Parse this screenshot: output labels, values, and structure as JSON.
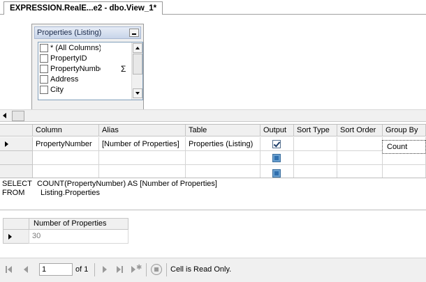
{
  "tab": {
    "title": "EXPRESSION.RealE...e2 - dbo.View_1*"
  },
  "diagram": {
    "table_title": "Properties (Listing)",
    "columns": [
      {
        "name": "* (All Columns)",
        "checked": false
      },
      {
        "name": "PropertyID",
        "checked": false
      },
      {
        "name": "PropertyNumbe",
        "checked": false,
        "aggregate_icon": "Σ"
      },
      {
        "name": "Address",
        "checked": false
      },
      {
        "name": "City",
        "checked": false
      }
    ]
  },
  "grid": {
    "headers": [
      "Column",
      "Alias",
      "Table",
      "Output",
      "Sort Type",
      "Sort Order",
      "Group By"
    ],
    "rows": [
      {
        "column": "PropertyNumber",
        "alias": "[Number of Properties]",
        "table": "Properties (Listing)",
        "output": true,
        "sort_type": "",
        "sort_order": "",
        "group_by": "Count"
      }
    ]
  },
  "sql": {
    "select_kw": "SELECT",
    "select_body": "COUNT(PropertyNumber) AS [Number of Properties]",
    "from_kw": "FROM",
    "from_body": "Listing.Properties"
  },
  "results": {
    "header": "Number of Properties",
    "value": "30"
  },
  "nav": {
    "page": "1",
    "of_label": "of 1",
    "status": "Cell is Read Only."
  }
}
